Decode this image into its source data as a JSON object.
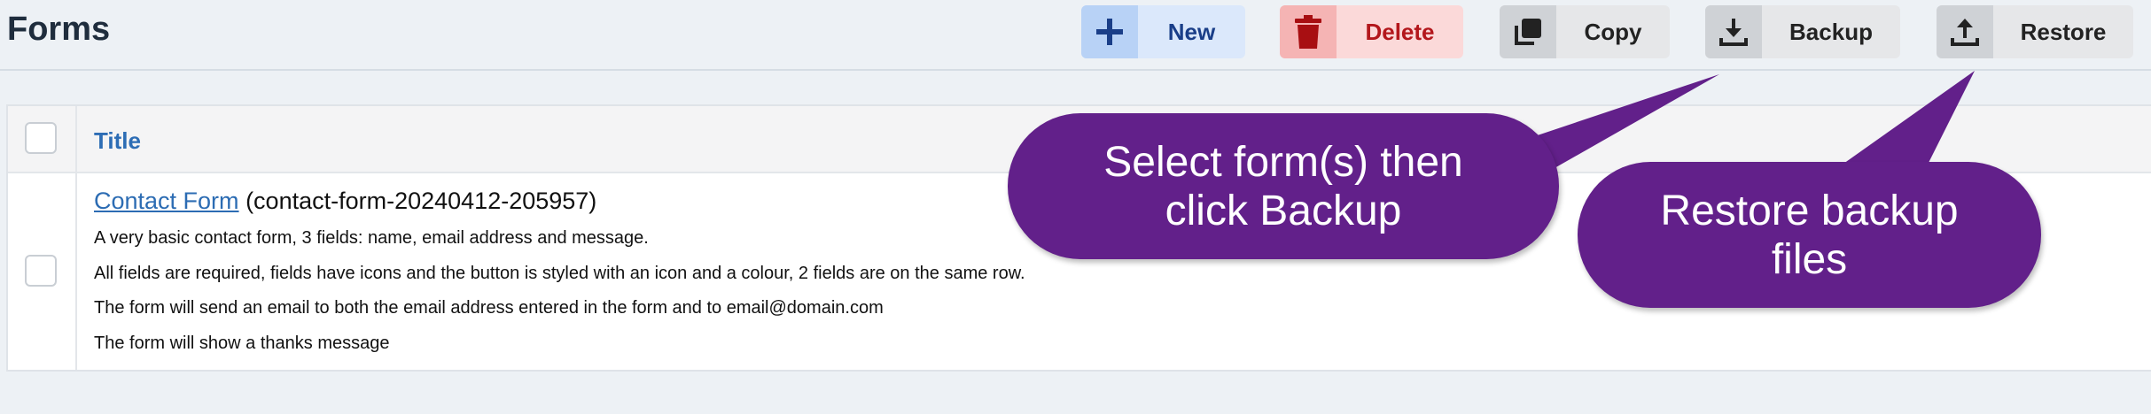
{
  "header": {
    "title": "Forms"
  },
  "toolbar": {
    "new_label": "New",
    "delete_label": "Delete",
    "copy_label": "Copy",
    "backup_label": "Backup",
    "restore_label": "Restore"
  },
  "colors": {
    "accent_blue": "#2d6db5",
    "delete_red": "#b3171c",
    "callout_purple": "#62208a"
  },
  "table": {
    "header_title": "Title",
    "rows": [
      {
        "link_text": "Contact Form",
        "slug": "(contact-form-20240412-205957)",
        "description": [
          "A very basic contact form, 3 fields: name, email address and message.",
          "All fields are required, fields have icons and the button is styled with an icon and a colour, 2 fields are on the same row.",
          "The form will send an email to both the email address entered in the form and to email@domain.com",
          "The form will show a thanks message"
        ]
      }
    ]
  },
  "callouts": {
    "backup_line1": "Select form(s) then",
    "backup_line2": "click Backup",
    "restore_line1": "Restore backup",
    "restore_line2": "files"
  },
  "icons": [
    "plus-icon",
    "trash-icon",
    "copy-icon",
    "download-icon",
    "upload-icon"
  ]
}
